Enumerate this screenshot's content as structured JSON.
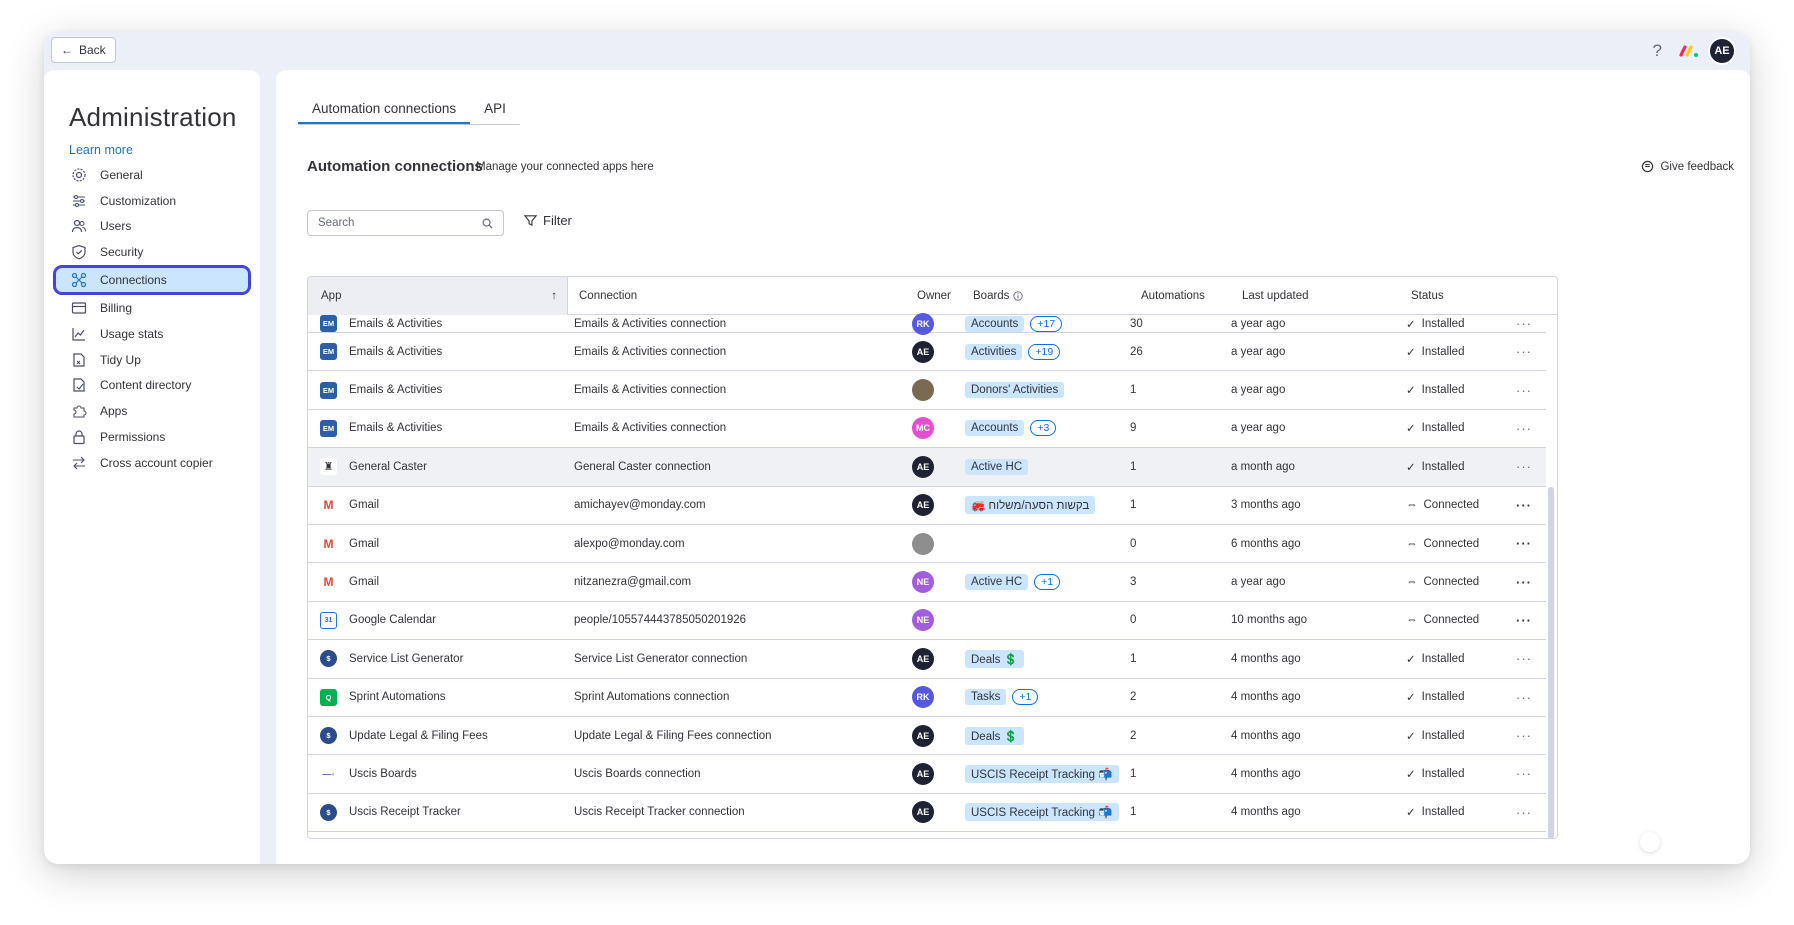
{
  "topbar": {
    "back_label": "Back",
    "help": "?",
    "user_initials": "AE"
  },
  "sidebar": {
    "title": "Administration",
    "learn_more": "Learn more",
    "items": [
      {
        "label": "General",
        "icon": "gear-icon"
      },
      {
        "label": "Customization",
        "icon": "sliders-icon"
      },
      {
        "label": "Users",
        "icon": "users-icon"
      },
      {
        "label": "Security",
        "icon": "shield-icon"
      },
      {
        "label": "Connections",
        "icon": "connections-icon"
      },
      {
        "label": "Billing",
        "icon": "credit-card-icon"
      },
      {
        "label": "Usage stats",
        "icon": "chart-icon"
      },
      {
        "label": "Tidy Up",
        "icon": "broom-icon"
      },
      {
        "label": "Content directory",
        "icon": "content-icon"
      },
      {
        "label": "Apps",
        "icon": "puzzle-icon"
      },
      {
        "label": "Permissions",
        "icon": "lock-icon"
      },
      {
        "label": "Cross account copier",
        "icon": "swap-icon"
      }
    ],
    "active_index": 4
  },
  "tabs": [
    {
      "label": "Automation connections"
    },
    {
      "label": "API"
    }
  ],
  "section": {
    "title": "Automation connections",
    "subtitle": "Manage your connected apps here",
    "feedback": "Give feedback"
  },
  "search": {
    "placeholder": "Search"
  },
  "filter_label": "Filter",
  "columns": {
    "app": "App",
    "sort": "↑",
    "connection": "Connection",
    "owner": "Owner",
    "boards": "Boards",
    "automations": "Automations",
    "last_updated": "Last updated",
    "status": "Status"
  },
  "rows": [
    {
      "app": "Emails & Activities",
      "icon_text": "EM",
      "icon_color": "#2b5fa8",
      "connection": "Emails & Activities connection",
      "owner": "RK",
      "owner_color": "#5559df",
      "board": "Accounts",
      "extra": "+17",
      "automations": "30",
      "updated": "a year ago",
      "status_icon": "✓",
      "status": "Installed",
      "more": "···"
    },
    {
      "app": "Emails & Activities",
      "icon_text": "EM",
      "icon_color": "#2b5fa8",
      "connection": "Emails & Activities connection",
      "owner": "AE",
      "owner_color": "#1f2233",
      "board": "Activities",
      "extra": "+19",
      "automations": "26",
      "updated": "a year ago",
      "status_icon": "✓",
      "status": "Installed",
      "more": "···"
    },
    {
      "app": "Emails & Activities",
      "icon_text": "EM",
      "icon_color": "#2b5fa8",
      "connection": "Emails & Activities connection",
      "owner": "",
      "owner_color": "#7a6a52",
      "board": "Donors' Activities",
      "extra": "",
      "automations": "1",
      "updated": "a year ago",
      "status_icon": "✓",
      "status": "Installed",
      "more": "···"
    },
    {
      "app": "Emails & Activities",
      "icon_text": "EM",
      "icon_color": "#2b5fa8",
      "connection": "Emails & Activities connection",
      "owner": "MC",
      "owner_color": "#e44ed0",
      "board": "Accounts",
      "extra": "+3",
      "automations": "9",
      "updated": "a year ago",
      "status_icon": "✓",
      "status": "Installed",
      "more": "···"
    },
    {
      "app": "General Caster",
      "icon_text": "♜",
      "icon_color": "#ffffff",
      "connection": "General Caster connection",
      "owner": "AE",
      "owner_color": "#1f2233",
      "board": "Active HC",
      "extra": "",
      "automations": "1",
      "updated": "a month ago",
      "status_icon": "✓",
      "status": "Installed",
      "more": "···"
    },
    {
      "app": "Gmail",
      "icon_text": "M",
      "icon_color": "#ffffff",
      "connection": "amichayev@monday.com",
      "owner": "AE",
      "owner_color": "#1f2233",
      "board": "🚒 בקשות הסעה/משלוח",
      "extra": "",
      "automations": "1",
      "updated": "3 months ago",
      "status_icon": "⇔",
      "status": "Connected",
      "more": "···"
    },
    {
      "app": "Gmail",
      "icon_text": "M",
      "icon_color": "#ffffff",
      "connection": "alexpo@monday.com",
      "owner": "",
      "owner_color": "#8d8d8d",
      "board": "",
      "extra": "",
      "automations": "0",
      "updated": "6 months ago",
      "status_icon": "⇔",
      "status": "Connected",
      "more": "···"
    },
    {
      "app": "Gmail",
      "icon_text": "M",
      "icon_color": "#ffffff",
      "connection": "nitzanezra@gmail.com",
      "owner": "NE",
      "owner_color": "#a25ddc",
      "board": "Active HC",
      "extra": "+1",
      "automations": "3",
      "updated": "a year ago",
      "status_icon": "⇔",
      "status": "Connected",
      "more": "···"
    },
    {
      "app": "Google Calendar",
      "icon_text": "31",
      "icon_color": "#ffffff",
      "connection": "people/105574443785050201926",
      "owner": "NE",
      "owner_color": "#a25ddc",
      "board": "",
      "extra": "",
      "automations": "0",
      "updated": "10 months ago",
      "status_icon": "⇔",
      "status": "Connected",
      "more": "···"
    },
    {
      "app": "Service List Generator",
      "icon_text": "$",
      "icon_color": "#2b4d8c",
      "connection": "Service List Generator connection",
      "owner": "AE",
      "owner_color": "#1f2233",
      "board": "Deals 💲",
      "extra": "",
      "automations": "1",
      "updated": "4 months ago",
      "status_icon": "✓",
      "status": "Installed",
      "more": "···"
    },
    {
      "app": "Sprint Automations",
      "icon_text": "Q",
      "icon_color": "#00b14f",
      "connection": "Sprint Automations connection",
      "owner": "RK",
      "owner_color": "#5559df",
      "board": "Tasks",
      "extra": "+1",
      "automations": "2",
      "updated": "4 months ago",
      "status_icon": "✓",
      "status": "Installed",
      "more": "···"
    },
    {
      "app": "Update Legal & Filing Fees",
      "icon_text": "$",
      "icon_color": "#2b4d8c",
      "connection": "Update Legal & Filing Fees connection",
      "owner": "AE",
      "owner_color": "#1f2233",
      "board": "Deals 💲",
      "extra": "",
      "automations": "2",
      "updated": "4 months ago",
      "status_icon": "✓",
      "status": "Installed",
      "more": "···"
    },
    {
      "app": "Uscis Boards",
      "icon_text": "—◦",
      "icon_color": "#ffffff",
      "connection": "Uscis Boards connection",
      "owner": "AE",
      "owner_color": "#1f2233",
      "board": "USCIS Receipt Tracking 📬",
      "extra": "",
      "automations": "1",
      "updated": "4 months ago",
      "status_icon": "✓",
      "status": "Installed",
      "more": "···"
    },
    {
      "app": "Uscis Receipt Tracker",
      "icon_text": "$",
      "icon_color": "#2b4d8c",
      "connection": "Uscis Receipt Tracker connection",
      "owner": "AE",
      "owner_color": "#1f2233",
      "board": "USCIS Receipt Tracking 📬",
      "extra": "",
      "automations": "1",
      "updated": "4 months ago",
      "status_icon": "✓",
      "status": "Installed",
      "more": "···"
    }
  ]
}
